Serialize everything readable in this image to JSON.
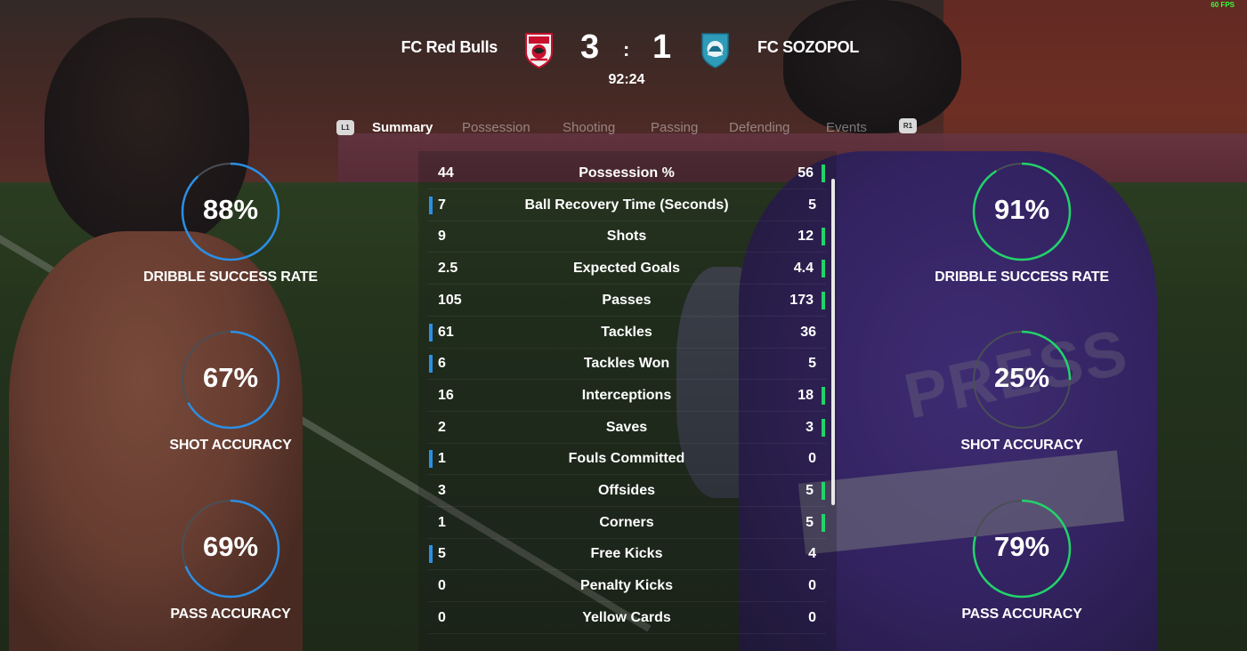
{
  "colors": {
    "home_accent": "#2b8fe6",
    "away_accent": "#22d36a",
    "ring_track": "#4a4f55"
  },
  "hud": {
    "fps": "60 FPS"
  },
  "header": {
    "home_team": "FC Red Bulls",
    "away_team": "FC SOZOPOL",
    "home_score": "3",
    "separator": ":",
    "away_score": "1",
    "clock": "92:24"
  },
  "tabs": {
    "prev_hint": "L1",
    "next_hint": "R1",
    "items": [
      "Summary",
      "Possession",
      "Shooting",
      "Passing",
      "Defending",
      "Events"
    ],
    "active": "Summary"
  },
  "stats": [
    {
      "name": "Possession %",
      "home": "44",
      "away": "56",
      "leader": "away"
    },
    {
      "name": "Ball Recovery Time (Seconds)",
      "home": "7",
      "away": "5",
      "leader": "home"
    },
    {
      "name": "Shots",
      "home": "9",
      "away": "12",
      "leader": "away"
    },
    {
      "name": "Expected Goals",
      "home": "2.5",
      "away": "4.4",
      "leader": "away"
    },
    {
      "name": "Passes",
      "home": "105",
      "away": "173",
      "leader": "away"
    },
    {
      "name": "Tackles",
      "home": "61",
      "away": "36",
      "leader": "home"
    },
    {
      "name": "Tackles Won",
      "home": "6",
      "away": "5",
      "leader": "home"
    },
    {
      "name": "Interceptions",
      "home": "16",
      "away": "18",
      "leader": "away"
    },
    {
      "name": "Saves",
      "home": "2",
      "away": "3",
      "leader": "away"
    },
    {
      "name": "Fouls Committed",
      "home": "1",
      "away": "0",
      "leader": "home"
    },
    {
      "name": "Offsides",
      "home": "3",
      "away": "5",
      "leader": "away"
    },
    {
      "name": "Corners",
      "home": "1",
      "away": "5",
      "leader": "away"
    },
    {
      "name": "Free Kicks",
      "home": "5",
      "away": "4",
      "leader": "home"
    },
    {
      "name": "Penalty Kicks",
      "home": "0",
      "away": "0",
      "leader": "none"
    },
    {
      "name": "Yellow Cards",
      "home": "0",
      "away": "0",
      "leader": "none"
    }
  ],
  "rings": {
    "home": [
      {
        "label": "DRIBBLE SUCCESS RATE",
        "pct_text": "88%",
        "value": 0.88
      },
      {
        "label": "SHOT ACCURACY",
        "pct_text": "67%",
        "value": 0.67
      },
      {
        "label": "PASS ACCURACY",
        "pct_text": "69%",
        "value": 0.69
      }
    ],
    "away": [
      {
        "label": "DRIBBLE SUCCESS RATE",
        "pct_text": "91%",
        "value": 0.91
      },
      {
        "label": "SHOT ACCURACY",
        "pct_text": "25%",
        "value": 0.25
      },
      {
        "label": "PASS ACCURACY",
        "pct_text": "79%",
        "value": 0.79
      }
    ]
  }
}
